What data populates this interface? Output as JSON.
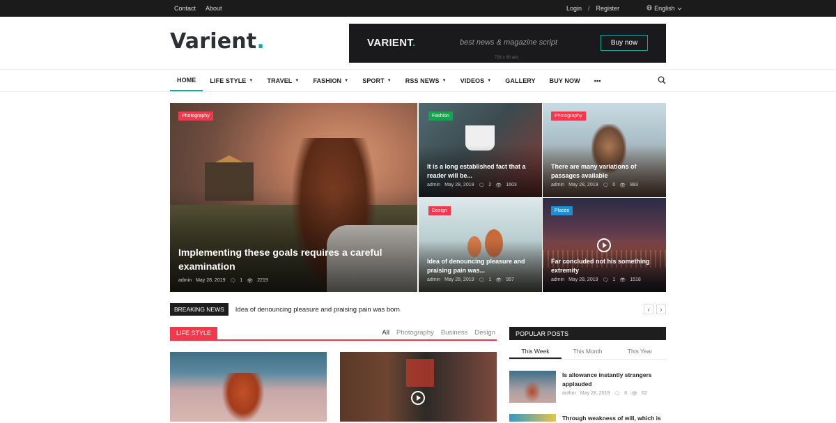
{
  "topbar": {
    "links": [
      "Contact",
      "About"
    ],
    "login": "Login",
    "separator": "/",
    "register": "Register",
    "language": "English",
    "language_icon": "globe-icon",
    "caret_icon": "chevron-down-icon"
  },
  "header": {
    "logo_text": "Varient",
    "logo_dot": ".",
    "accent_color": "#16a8a0"
  },
  "ad": {
    "brand": "VARIENT",
    "brand_dot": ".",
    "tagline": "best news & magazine script",
    "size_label": "728 x 90 ads",
    "button": "Buy now"
  },
  "nav": {
    "items": [
      {
        "label": "HOME",
        "active": true,
        "dropdown": false
      },
      {
        "label": "LIFE STYLE",
        "dropdown": true
      },
      {
        "label": "TRAVEL",
        "dropdown": true
      },
      {
        "label": "FASHION",
        "dropdown": true
      },
      {
        "label": "SPORT",
        "dropdown": true
      },
      {
        "label": "RSS NEWS",
        "dropdown": true
      },
      {
        "label": "VIDEOS",
        "dropdown": true
      },
      {
        "label": "GALLERY",
        "dropdown": false
      },
      {
        "label": "BUY NOW",
        "dropdown": false
      }
    ],
    "more": "•••",
    "search_icon": "search-icon"
  },
  "featured": {
    "main": {
      "category": "Photography",
      "title": "Implementing these goals requires a careful examination",
      "author": "admin",
      "date": "May 28, 2019",
      "comments": "1",
      "views": "2219"
    },
    "small": [
      {
        "category": "Fashion",
        "title": "It is a long established fact that a reader will be...",
        "author": "admin",
        "date": "May 28, 2019",
        "comments": "2",
        "views": "1603"
      },
      {
        "category": "Photography",
        "title": "There are many variations of passages available",
        "author": "admin",
        "date": "May 28, 2019",
        "comments": "0",
        "views": "883"
      },
      {
        "category": "Design",
        "title": "Idea of denouncing pleasure and praising pain was...",
        "author": "admin",
        "date": "May 28, 2019",
        "comments": "1",
        "views": "957"
      },
      {
        "category": "Places",
        "title": "Far concluded not his something extremity",
        "author": "admin",
        "date": "May 28, 2019",
        "comments": "1",
        "views": "1518"
      }
    ]
  },
  "breaking": {
    "label": "BREAKING NEWS",
    "text": "Idea of denouncing pleasure and praising pain was born",
    "prev": "‹",
    "next": "›"
  },
  "lifestyle": {
    "label": "LIFE STYLE",
    "tabs": [
      "All",
      "Photography",
      "Business",
      "Design"
    ]
  },
  "popular": {
    "label": "POPULAR POSTS",
    "tabs": [
      "This Week",
      "This Month",
      "This Year"
    ],
    "posts": [
      {
        "title": "Is allowance instantly strangers applauded",
        "author": "author",
        "date": "May 28, 2019",
        "comments": "8",
        "views": "62"
      },
      {
        "title": "Through weakness of will, which is"
      }
    ]
  },
  "icons": {
    "comments": "comment-icon",
    "views": "eye-icon",
    "play": "play-icon"
  }
}
